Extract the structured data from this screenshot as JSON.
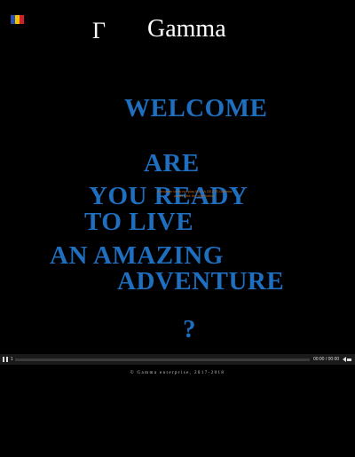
{
  "colors": {
    "background": "#000000",
    "accent": "#1e6fbf",
    "tiny_text": "#c46a1a",
    "flag": [
      "#2b4fb0",
      "#f2c200",
      "#d0202a"
    ]
  },
  "header": {
    "logo_glyph": "Γ",
    "title": "Gamma",
    "language_flag_icon": "flag-icon"
  },
  "main": {
    "lines": [
      "WELCOME",
      "ARE",
      "YOU READY",
      "TO LIVE",
      "AN AMAZING",
      "ADVENTURE",
      "?"
    ],
    "small_text": [
      "If browser does not play the LA GEZ IS Gamma",
      "audio click the play button"
    ]
  },
  "player": {
    "state": "playing",
    "progress_value": "1",
    "time_display": "00:00 / 00:00",
    "progress_fraction": 0.0
  },
  "footer": {
    "copyright": "© Gamma enterprise, 2017-2018"
  }
}
